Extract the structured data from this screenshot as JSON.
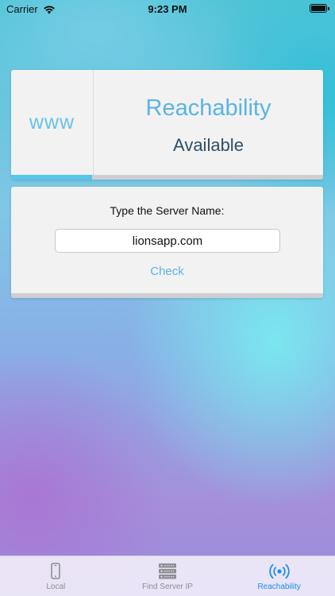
{
  "status_bar": {
    "carrier": "Carrier",
    "time": "9:23 PM",
    "battery_level": 1.0
  },
  "reachability_card": {
    "www_label": "www",
    "title": "Reachability",
    "status": "Available",
    "progress": 0.26
  },
  "server_form": {
    "label": "Type the Server Name:",
    "server_value": "lionsapp.com",
    "check_label": "Check"
  },
  "tab_bar": {
    "tabs": [
      {
        "label": "Local",
        "icon": "phone-icon",
        "active": false
      },
      {
        "label": "Find Server IP",
        "icon": "server-rack-icon",
        "active": false
      },
      {
        "label": "Reachability",
        "icon": "broadcast-icon",
        "active": true
      }
    ]
  },
  "colors": {
    "accent": "#5ab4e0",
    "active_tab": "#1b8fe8",
    "inactive_tab": "#8e8e93",
    "progress": "#56c6ea"
  }
}
